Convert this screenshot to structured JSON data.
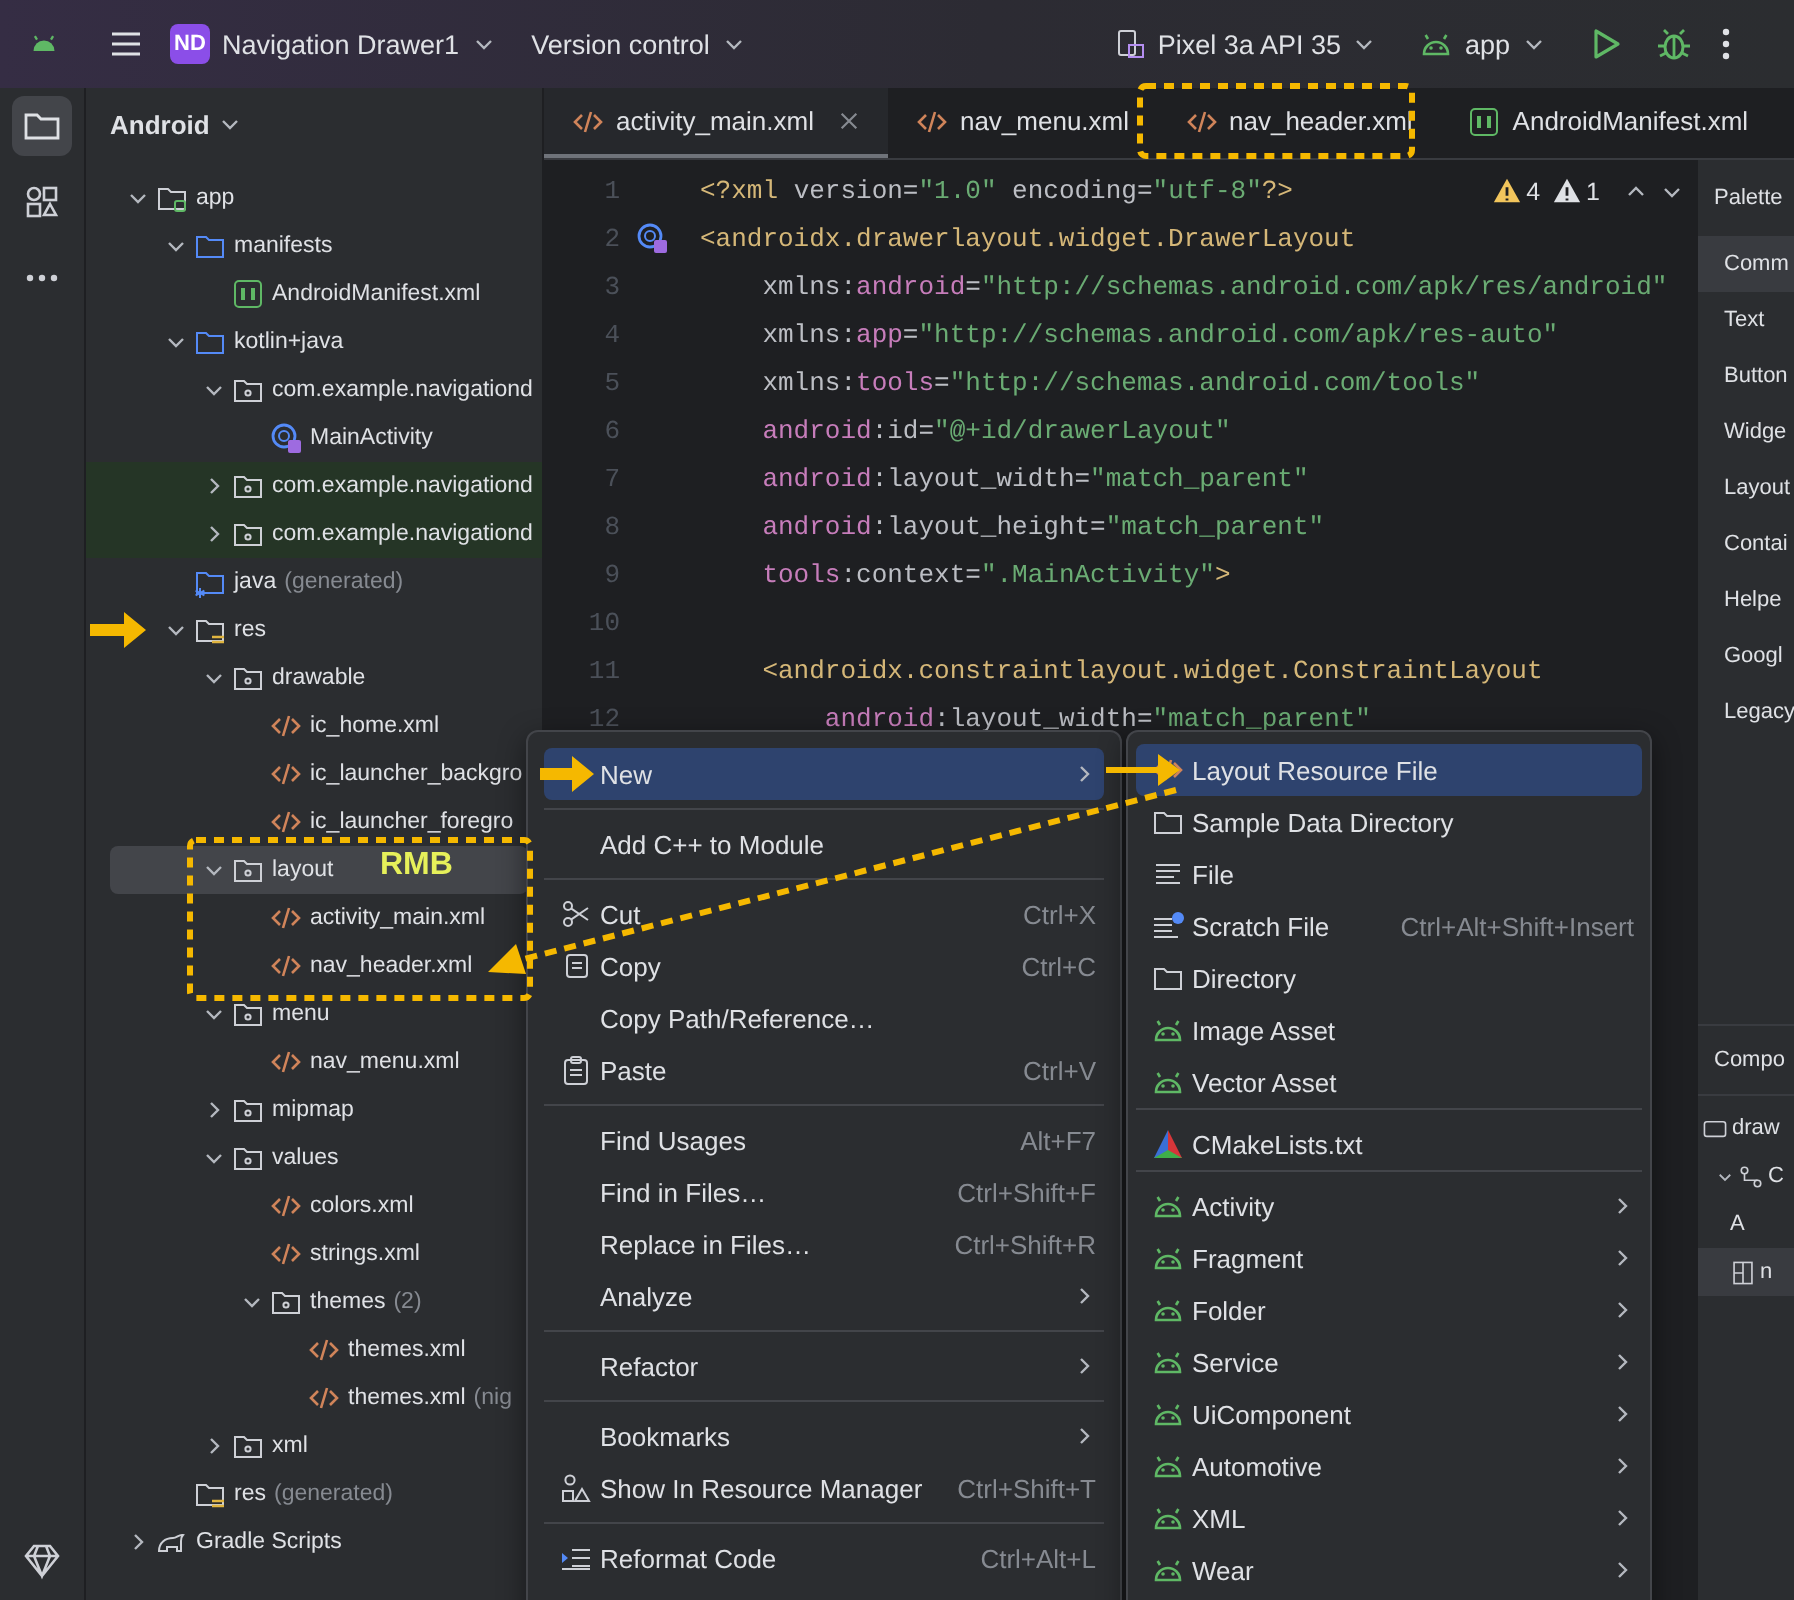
{
  "top_bar": {
    "project_badge": "ND",
    "project_name": "Navigation Drawer1",
    "vcs": "Version control",
    "device": "Pixel 3a API 35",
    "run_config": "app"
  },
  "tool_strip": [
    {
      "kind": "project",
      "selected": true
    },
    {
      "kind": "structure",
      "selected": false
    },
    {
      "kind": "more",
      "selected": false
    }
  ],
  "project_panel": {
    "view": "Android",
    "tree": [
      {
        "label": "app",
        "kind": "module",
        "expanded": true,
        "selected": false,
        "children": [
          {
            "label": "manifests",
            "kind": "folder",
            "expanded": true,
            "selected": false,
            "children": [
              {
                "label": "AndroidManifest.xml",
                "kind": "manifest",
                "selected": false
              }
            ]
          },
          {
            "label": "kotlin+java",
            "kind": "folder",
            "expanded": true,
            "selected": false,
            "children": [
              {
                "label": "com.example.navigationd",
                "kind": "package",
                "expanded": true,
                "selected": false,
                "children": [
                  {
                    "label": "MainActivity",
                    "kind": "activity",
                    "selected": false
                  }
                ]
              },
              {
                "label": "com.example.navigationd",
                "kind": "test-package",
                "expanded": false,
                "selected": false
              },
              {
                "label": "com.example.navigationd",
                "kind": "test-package",
                "expanded": false,
                "selected": false
              }
            ]
          },
          {
            "label": "java",
            "note": "(generated)",
            "kind": "generated-folder",
            "selected": false
          },
          {
            "label": "res",
            "kind": "res-folder",
            "expanded": true,
            "selected": false,
            "children": [
              {
                "label": "drawable",
                "kind": "package",
                "expanded": true,
                "selected": false,
                "children": [
                  {
                    "label": "ic_home.xml",
                    "kind": "xml",
                    "selected": false
                  },
                  {
                    "label": "ic_launcher_backgro",
                    "kind": "xml",
                    "selected": false
                  },
                  {
                    "label": "ic_launcher_foregro",
                    "kind": "xml",
                    "selected": false
                  }
                ]
              },
              {
                "label": "layout",
                "kind": "package",
                "expanded": true,
                "selected": true,
                "children": [
                  {
                    "label": "activity_main.xml",
                    "kind": "xml",
                    "selected": false
                  },
                  {
                    "label": "nav_header.xml",
                    "kind": "xml",
                    "selected": false
                  }
                ]
              },
              {
                "label": "menu",
                "kind": "package",
                "expanded": true,
                "selected": false,
                "children": [
                  {
                    "label": "nav_menu.xml",
                    "kind": "xml",
                    "selected": false
                  }
                ]
              },
              {
                "label": "mipmap",
                "kind": "package",
                "expanded": false,
                "selected": false
              },
              {
                "label": "values",
                "kind": "package",
                "expanded": true,
                "selected": false,
                "children": [
                  {
                    "label": "colors.xml",
                    "kind": "xml",
                    "selected": false
                  },
                  {
                    "label": "strings.xml",
                    "kind": "xml",
                    "selected": false
                  },
                  {
                    "label": "themes",
                    "note": "(2)",
                    "kind": "package",
                    "expanded": true,
                    "selected": false,
                    "children": [
                      {
                        "label": "themes.xml",
                        "kind": "xml",
                        "selected": false
                      },
                      {
                        "label": "themes.xml",
                        "note": "(nig",
                        "kind": "xml",
                        "selected": false
                      }
                    ]
                  }
                ]
              },
              {
                "label": "xml",
                "kind": "package",
                "expanded": false,
                "selected": false
              }
            ]
          },
          {
            "label": "res",
            "note": "(generated)",
            "kind": "res-folder",
            "selected": false
          }
        ]
      },
      {
        "label": "Gradle Scripts",
        "kind": "gradle",
        "expanded": false,
        "selected": false
      }
    ]
  },
  "editor": {
    "tabs": [
      {
        "label": "activity_main.xml",
        "kind": "xml",
        "selected": true,
        "closable": true
      },
      {
        "label": "nav_menu.xml",
        "kind": "xml",
        "selected": false,
        "closable": false
      },
      {
        "label": "nav_header.xml",
        "kind": "xml",
        "selected": false,
        "closable": false
      },
      {
        "label": "AndroidManifest.xml",
        "kind": "manifest",
        "selected": false,
        "closable": false
      }
    ],
    "inspections": [
      {
        "kind": "warning",
        "count": "4"
      },
      {
        "kind": "weak-warning",
        "count": "1"
      }
    ],
    "lines": [
      {
        "number": "1",
        "segments": [
          {
            "kind": "tag",
            "text": "<?xml"
          },
          {
            "kind": "plain",
            "text": " version="
          },
          {
            "kind": "str",
            "text": "\"1.0\""
          },
          {
            "kind": "plain",
            "text": " encoding="
          },
          {
            "kind": "str",
            "text": "\"utf-8\""
          },
          {
            "kind": "tag",
            "text": "?>"
          }
        ]
      },
      {
        "number": "2",
        "gutter_marker": {
          "kind": "activity"
        },
        "segments": [
          {
            "kind": "tag",
            "text": "<androidx.drawerlayout.widget.DrawerLayout"
          }
        ]
      },
      {
        "number": "3",
        "segments": [
          {
            "kind": "plain",
            "text": "    xmlns:"
          },
          {
            "kind": "ns",
            "text": "android"
          },
          {
            "kind": "plain",
            "text": "="
          },
          {
            "kind": "str",
            "text": "\"http://schemas.android.com/apk/res/android\""
          }
        ]
      },
      {
        "number": "4",
        "segments": [
          {
            "kind": "plain",
            "text": "    xmlns:"
          },
          {
            "kind": "ns",
            "text": "app"
          },
          {
            "kind": "plain",
            "text": "="
          },
          {
            "kind": "str",
            "text": "\"http://schemas.android.com/apk/res-auto\""
          }
        ]
      },
      {
        "number": "5",
        "segments": [
          {
            "kind": "plain",
            "text": "    xmlns:"
          },
          {
            "kind": "ns",
            "text": "tools"
          },
          {
            "kind": "plain",
            "text": "="
          },
          {
            "kind": "str",
            "text": "\"http://schemas.android.com/tools\""
          }
        ]
      },
      {
        "number": "6",
        "segments": [
          {
            "kind": "ns",
            "text": "    android"
          },
          {
            "kind": "plain",
            "text": ":id="
          },
          {
            "kind": "str",
            "text": "\"@+id/drawerLayout\""
          }
        ]
      },
      {
        "number": "7",
        "segments": [
          {
            "kind": "ns",
            "text": "    android"
          },
          {
            "kind": "plain",
            "text": ":layout_width="
          },
          {
            "kind": "str",
            "text": "\"match_parent\""
          }
        ]
      },
      {
        "number": "8",
        "segments": [
          {
            "kind": "ns",
            "text": "    android"
          },
          {
            "kind": "plain",
            "text": ":layout_height="
          },
          {
            "kind": "str",
            "text": "\"match_parent\""
          }
        ]
      },
      {
        "number": "9",
        "segments": [
          {
            "kind": "ns",
            "text": "    tools"
          },
          {
            "kind": "plain",
            "text": ":context="
          },
          {
            "kind": "str",
            "text": "\".MainActivity\""
          },
          {
            "kind": "tag",
            "text": ">"
          }
        ]
      },
      {
        "number": "10"
      },
      {
        "number": "11",
        "segments": [
          {
            "kind": "tag",
            "text": "    <androidx.constraintlayout.widget.ConstraintLayout"
          }
        ]
      },
      {
        "number": "12",
        "segments": [
          {
            "kind": "ns",
            "text": "        android"
          },
          {
            "kind": "plain",
            "text": ":layout_width="
          },
          {
            "kind": "str",
            "text": "\"match_parent\""
          }
        ]
      }
    ]
  },
  "palette": {
    "title": "Palette",
    "categories": [
      {
        "label": "Comm",
        "selected": true
      },
      {
        "label": "Text",
        "selected": false
      },
      {
        "label": "Button",
        "selected": false
      },
      {
        "label": "Widge",
        "selected": false
      },
      {
        "label": "Layout",
        "selected": false
      },
      {
        "label": "Contai",
        "selected": false
      },
      {
        "label": "Helpe",
        "selected": false
      },
      {
        "label": "Googl",
        "selected": false
      },
      {
        "label": "Legacy",
        "selected": false
      }
    ],
    "component_tree": {
      "title": "Compo",
      "items": [
        {
          "label": "draw",
          "kind": "view",
          "selected": false,
          "children": [
            {
              "label": "C",
              "kind": "constraint",
              "expanded": true,
              "selected": false,
              "children": [
                {
                  "label": "A",
                  "selected": false
                },
                {
                  "label": "n",
                  "kind": "layout",
                  "selected": true
                }
              ]
            }
          ]
        }
      ]
    }
  },
  "context_menu": {
    "sections": [
      [
        {
          "label": "New",
          "submenu": true,
          "selected": true
        }
      ],
      [
        {
          "label": "Add C++ to Module",
          "submenu": false,
          "selected": false
        }
      ],
      [
        {
          "label": "Cut",
          "kind": "scissors",
          "shortcut": "Ctrl+X",
          "submenu": false,
          "selected": false
        },
        {
          "label": "Copy",
          "kind": "copy",
          "shortcut": "Ctrl+C",
          "submenu": false,
          "selected": false
        },
        {
          "label": "Copy Path/Reference…",
          "submenu": false,
          "selected": false
        },
        {
          "label": "Paste",
          "kind": "paste",
          "shortcut": "Ctrl+V",
          "submenu": false,
          "selected": false
        }
      ],
      [
        {
          "label": "Find Usages",
          "shortcut": "Alt+F7",
          "submenu": false,
          "selected": false
        },
        {
          "label": "Find in Files…",
          "shortcut": "Ctrl+Shift+F",
          "submenu": false,
          "selected": false
        },
        {
          "label": "Replace in Files…",
          "shortcut": "Ctrl+Shift+R",
          "submenu": false,
          "selected": false
        },
        {
          "label": "Analyze",
          "submenu": true,
          "selected": false
        }
      ],
      [
        {
          "label": "Refactor",
          "submenu": true,
          "selected": false
        }
      ],
      [
        {
          "label": "Bookmarks",
          "submenu": true,
          "selected": false
        },
        {
          "label": "Show In Resource Manager",
          "kind": "resources",
          "shortcut": "Ctrl+Shift+T",
          "submenu": false,
          "selected": false
        }
      ],
      [
        {
          "label": "Reformat Code",
          "kind": "reformat",
          "shortcut": "Ctrl+Alt+L",
          "submenu": false,
          "selected": false
        }
      ]
    ]
  },
  "new_submenu": {
    "sections": [
      [
        {
          "label": "Layout Resource File",
          "kind": "xml",
          "submenu": false,
          "selected": true
        },
        {
          "label": "Sample Data Directory",
          "kind": "plain-folder",
          "submenu": false,
          "selected": false
        },
        {
          "label": "File",
          "kind": "file",
          "submenu": false,
          "selected": false
        },
        {
          "label": "Scratch File",
          "kind": "scratch",
          "shortcut": "Ctrl+Alt+Shift+Insert",
          "submenu": false,
          "selected": false
        },
        {
          "label": "Directory",
          "kind": "plain-folder",
          "submenu": false,
          "selected": false
        },
        {
          "label": "Image Asset",
          "kind": "android",
          "submenu": false,
          "selected": false
        },
        {
          "label": "Vector Asset",
          "kind": "android",
          "submenu": false,
          "selected": false
        }
      ],
      [
        {
          "label": "CMakeLists.txt",
          "kind": "cmake",
          "submenu": false,
          "selected": false
        }
      ],
      [
        {
          "label": "Activity",
          "kind": "android",
          "submenu": true,
          "selected": false
        },
        {
          "label": "Fragment",
          "kind": "android",
          "submenu": true,
          "selected": false
        },
        {
          "label": "Folder",
          "kind": "android",
          "submenu": true,
          "selected": false
        },
        {
          "label": "Service",
          "kind": "android",
          "submenu": true,
          "selected": false
        },
        {
          "label": "UiComponent",
          "kind": "android",
          "submenu": true,
          "selected": false
        },
        {
          "label": "Automotive",
          "kind": "android",
          "submenu": true,
          "selected": false
        },
        {
          "label": "XML",
          "kind": "android",
          "submenu": true,
          "selected": false
        },
        {
          "label": "Wear",
          "kind": "android",
          "submenu": true,
          "selected": false
        }
      ]
    ]
  },
  "annotation": {
    "label": "RMB"
  }
}
